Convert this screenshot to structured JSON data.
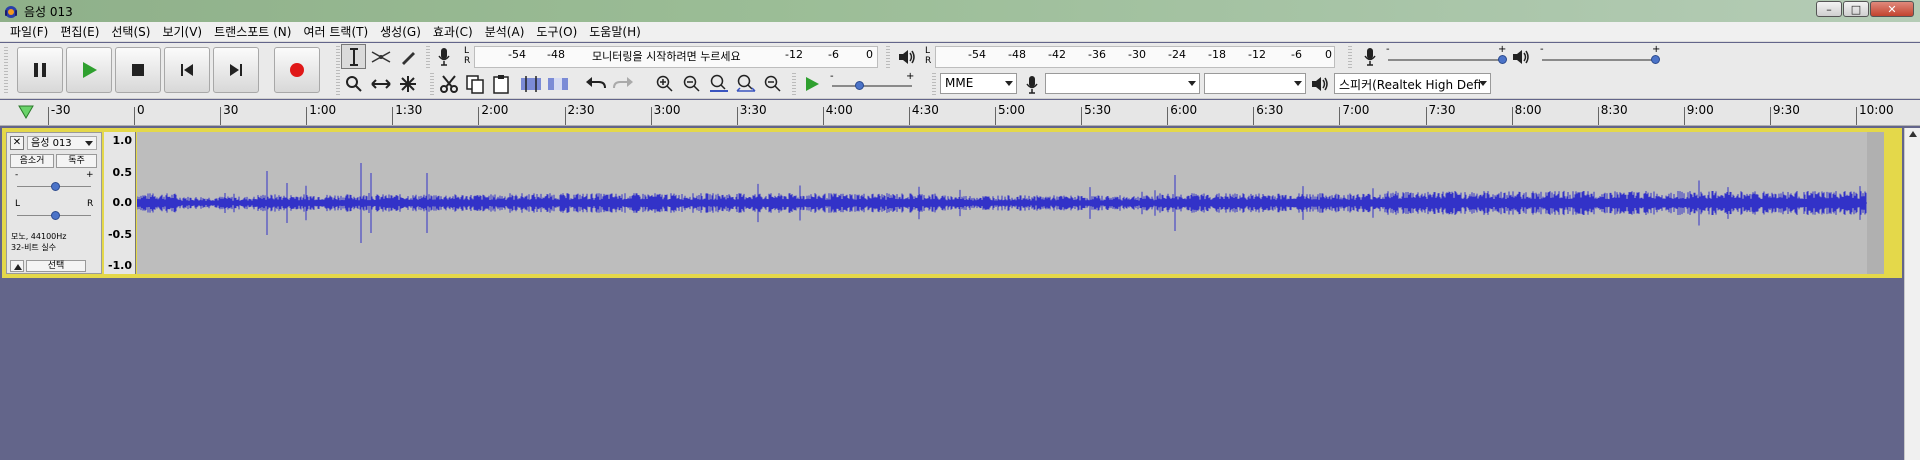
{
  "window": {
    "title": "음성 013",
    "minimize": "–",
    "restore": "□",
    "close": "✕"
  },
  "menu": [
    "파일(F)",
    "편집(E)",
    "선택(S)",
    "보기(V)",
    "트랜스포트 (N)",
    "여러 트랙(T)",
    "생성(G)",
    "효과(C)",
    "분석(A)",
    "도구(O)",
    "도움말(H)"
  ],
  "recording_meter": {
    "left_label": "L",
    "right_label": "R",
    "scale": [
      "-54",
      "-48",
      "-12",
      "-6",
      "0"
    ],
    "monitor_prompt": "모니터링을 시작하려면 누르세요"
  },
  "playback_meter": {
    "left_label": "L",
    "right_label": "R",
    "scale": [
      "-54",
      "-48",
      "-42",
      "-36",
      "-30",
      "-24",
      "-18",
      "-12",
      "-6",
      "0"
    ]
  },
  "sliders": {
    "rec_volume_min": "-",
    "rec_volume_max": "+",
    "play_volume_min": "-",
    "play_volume_max": "+",
    "play_speed_min": "-",
    "play_speed_max": "+"
  },
  "device": {
    "host": "MME",
    "recording_device": "",
    "channels": "",
    "playback_device": "스피커(Realtek High Defi"
  },
  "ruler": {
    "labels": [
      "-30",
      "0",
      "30",
      "1:00",
      "1:30",
      "2:00",
      "2:30",
      "3:00",
      "3:30",
      "4:00",
      "4:30",
      "5:00",
      "5:30",
      "6:00",
      "6:30",
      "7:00",
      "7:30",
      "8:00",
      "8:30",
      "9:00",
      "9:30",
      "10:00"
    ]
  },
  "track": {
    "name": "음성 013",
    "mute": "음소거",
    "solo": "독주",
    "gain_min": "-",
    "gain_max": "+",
    "pan_left": "L",
    "pan_right": "R",
    "info_line1": "모노, 44100Hz",
    "info_line2": "32-비트 실수",
    "select": "선택",
    "scale": [
      "1.0",
      "0.5",
      "0.0",
      "-0.5",
      "-1.0"
    ]
  },
  "colors": {
    "waveform": "#3232c8",
    "track_selected_border": "#e4d84a",
    "background": "#63658a",
    "record": "#e01818",
    "play": "#2fa02f"
  }
}
